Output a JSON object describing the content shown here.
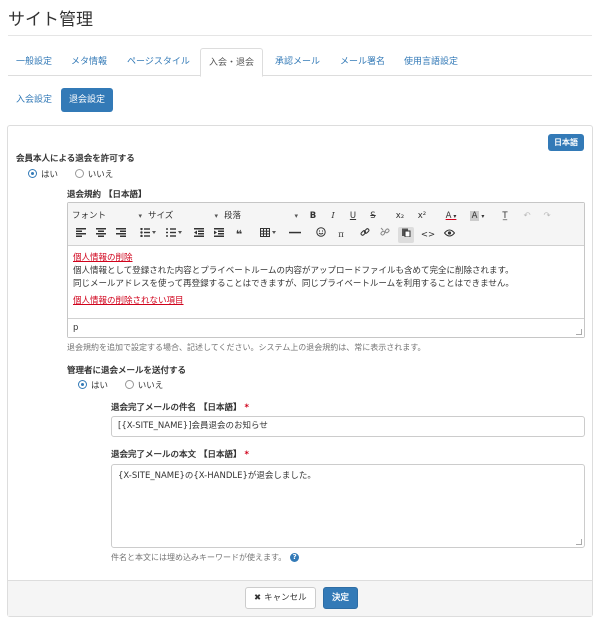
{
  "page": {
    "title": "サイト管理"
  },
  "tabs": [
    {
      "label": "一般設定"
    },
    {
      "label": "メタ情報"
    },
    {
      "label": "ページスタイル"
    },
    {
      "label": "入会・退会",
      "active": true
    },
    {
      "label": "承認メール"
    },
    {
      "label": "メール署名"
    },
    {
      "label": "使用言語設定"
    }
  ],
  "subtabs": [
    {
      "label": "入会設定"
    },
    {
      "label": "退会設定",
      "active": true
    }
  ],
  "lang_badge": "日本語",
  "allow_withdraw": {
    "label": "会員本人による退会を許可する",
    "options": [
      {
        "label": "はい",
        "checked": true
      },
      {
        "label": "いいえ",
        "checked": false
      }
    ]
  },
  "policy": {
    "label": "退会規約 【日本語】",
    "toolbar": {
      "font": "フォント",
      "size": "サイズ",
      "format": "段落",
      "bold": "B",
      "italic": "I",
      "underline": "U",
      "strike": "S",
      "subscript": "x₂",
      "superscript": "x²",
      "text_color": "A",
      "bg_color": "A",
      "clear_format": "T̲",
      "undo": "↶",
      "redo": "↷",
      "blockquote": "❝",
      "special_char": "π",
      "source": "<>"
    },
    "content": {
      "heading1": "個人情報の削除",
      "line1": "個人情報として登録された内容とプライベートルームの内容がアップロードファイルも含めて完全に削除されます。",
      "line2": "同じメールアドレスを使って再登録することはできますが、同じプライベートルームを利用することはできません。",
      "heading2": "個人情報の削除されない項目"
    },
    "status_path": "p",
    "help": "退会規約を追加で設定する場合、記述してください。システム上の退会規約は、常に表示されます。"
  },
  "send_mail": {
    "label": "管理者に退会メールを送付する",
    "options": [
      {
        "label": "はい",
        "checked": true
      },
      {
        "label": "いいえ",
        "checked": false
      }
    ]
  },
  "mail_subject": {
    "label": "退会完了メールの件名 【日本語】",
    "required": "*",
    "value": "[{X-SITE_NAME}]会員退会のお知らせ"
  },
  "mail_body": {
    "label": "退会完了メールの本文 【日本語】",
    "required": "*",
    "value": "{X-SITE_NAME}の{X-HANDLE}が退会しました。",
    "help": "件名と本文には埋め込みキーワードが使えます。"
  },
  "footer": {
    "cancel_label": "キャンセル",
    "submit_label": "決定"
  }
}
